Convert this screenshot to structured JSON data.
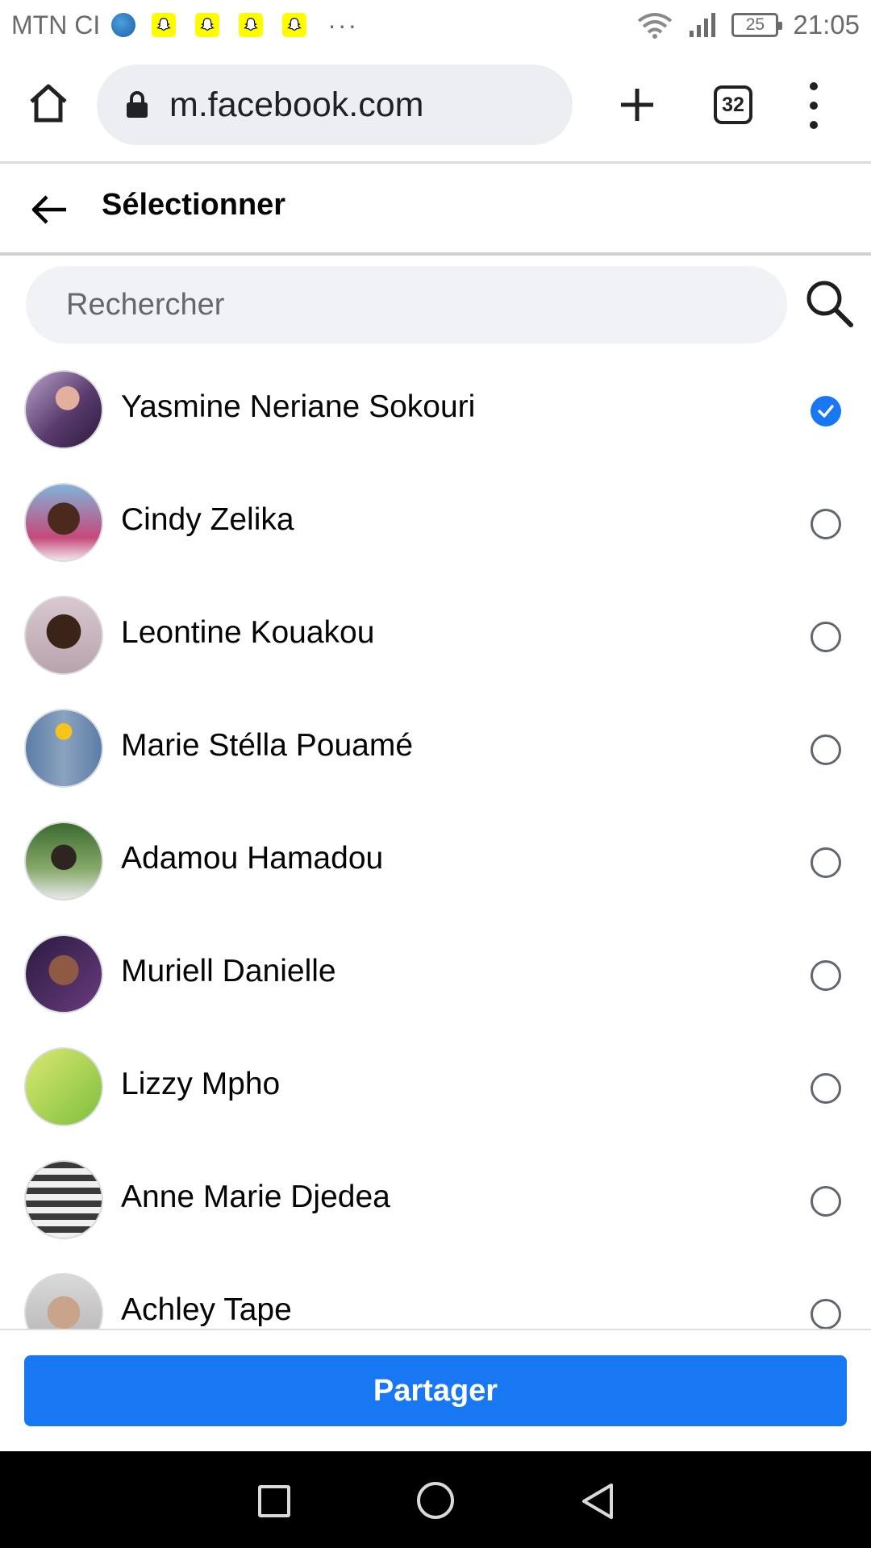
{
  "status_bar": {
    "carrier": "MTN CI",
    "more": "···",
    "battery": "25",
    "time": "21:05"
  },
  "browser": {
    "url": "m.facebook.com",
    "tab_count": "32"
  },
  "header": {
    "title": "Sélectionner"
  },
  "search": {
    "placeholder": "Rechercher"
  },
  "friends": [
    {
      "name": "Yasmine Neriane Sokouri",
      "selected": true
    },
    {
      "name": "Cindy Zelika",
      "selected": false
    },
    {
      "name": "Leontine Kouakou",
      "selected": false
    },
    {
      "name": "Marie Stélla Pouamé",
      "selected": false
    },
    {
      "name": "Adamou Hamadou",
      "selected": false
    },
    {
      "name": "Muriell Danielle",
      "selected": false
    },
    {
      "name": "Lizzy Mpho",
      "selected": false
    },
    {
      "name": "Anne Marie Djedea",
      "selected": false
    },
    {
      "name": "Achley Tape",
      "selected": false
    }
  ],
  "footer": {
    "share_label": "Partager"
  },
  "colors": {
    "accent": "#1877f2",
    "search_bg": "#f0f2f5",
    "url_bg": "#eceef1"
  }
}
